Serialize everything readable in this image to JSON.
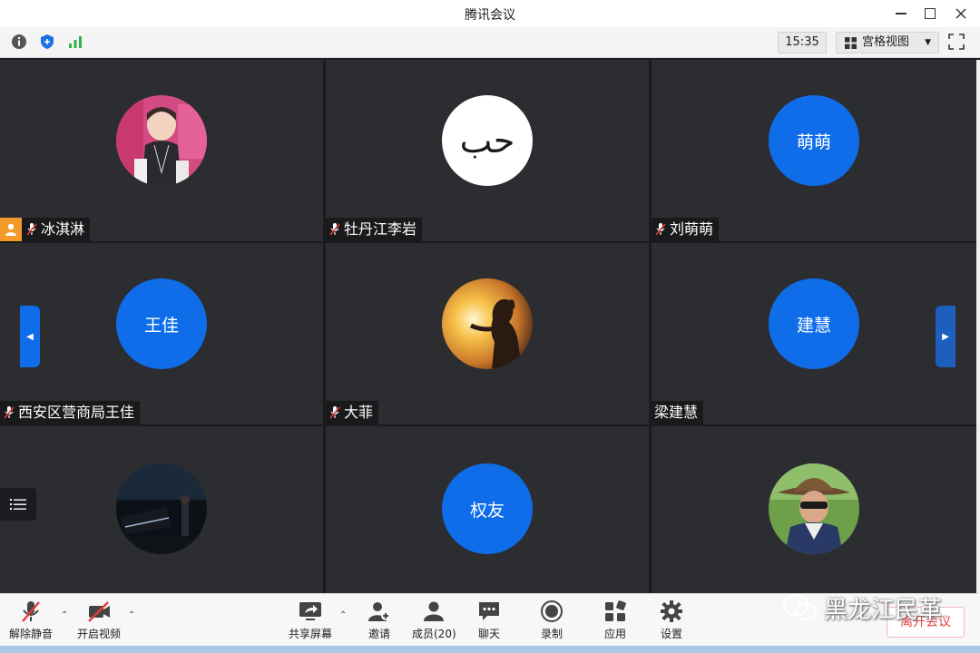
{
  "window": {
    "title": "腾讯会议"
  },
  "toolbar": {
    "time": "15:35",
    "view_label": "宫格视图",
    "icons": [
      "info-icon",
      "shield-icon",
      "signal-icon",
      "grid-icon",
      "fullscreen-icon"
    ]
  },
  "participants": [
    {
      "name": "冰淇淋",
      "avatar": "photo",
      "host": true,
      "muted": true
    },
    {
      "name": "牡丹江李岩",
      "avatar": "text",
      "avatar_text": "حب",
      "muted": true
    },
    {
      "name": "刘萌萌",
      "avatar": "initials",
      "avatar_text": "萌萌",
      "muted": true
    },
    {
      "name": "西安区营商局王佳",
      "avatar": "initials",
      "avatar_text": "王佳",
      "muted": true
    },
    {
      "name": "大菲",
      "avatar": "photo",
      "muted": true
    },
    {
      "name": "梁建慧",
      "avatar": "initials",
      "avatar_text": "建慧",
      "muted": false
    },
    {
      "name": "",
      "avatar": "photo"
    },
    {
      "name": "",
      "avatar": "initials",
      "avatar_text": "权友"
    },
    {
      "name": "",
      "avatar": "photo"
    }
  ],
  "controls": {
    "unmute": "解除静音",
    "start_video": "开启视频",
    "share_screen": "共享屏幕",
    "invite": "邀请",
    "members": "成员(20)",
    "chat": "聊天",
    "record": "录制",
    "apps": "应用",
    "settings": "设置",
    "leave": "离开会议"
  },
  "watermark": {
    "text": "黑龙江民革"
  },
  "colors": {
    "accent": "#0f6dea",
    "tile_bg": "#2c2d30",
    "host_badge": "#f39a2b",
    "leave": "#e24444"
  }
}
